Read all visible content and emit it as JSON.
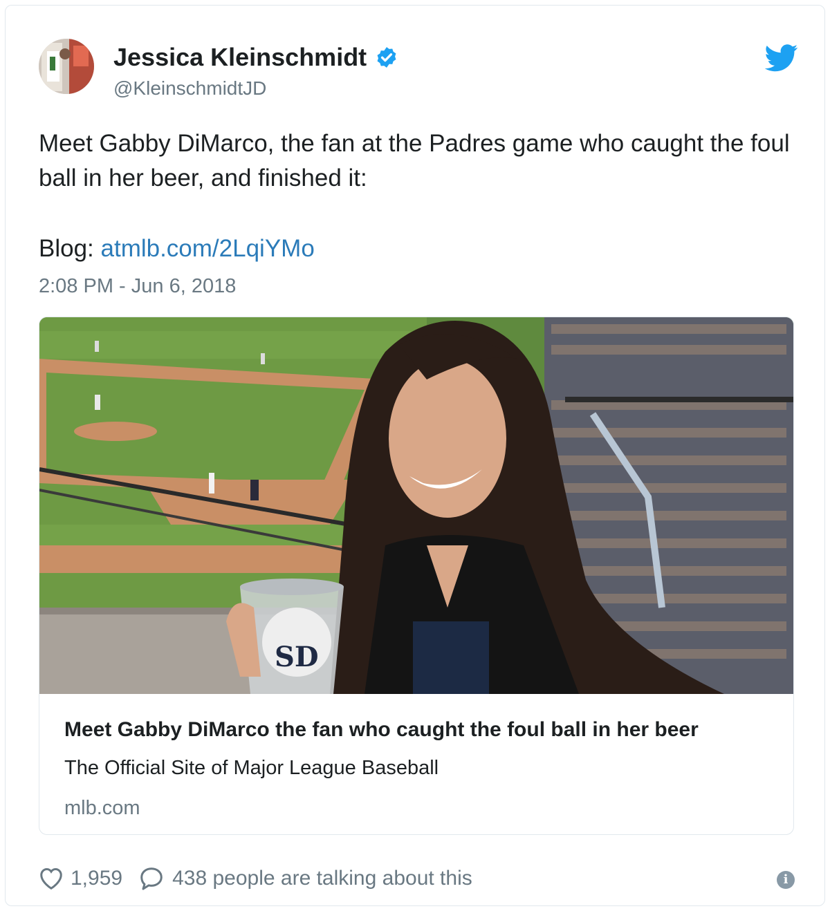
{
  "author": {
    "display_name": "Jessica Kleinschmidt",
    "handle": "@KleinschmidtJD",
    "verified": true
  },
  "tweet": {
    "text": "Meet Gabby DiMarco, the fan at the Padres game who caught the foul ball in her beer, and finished it:",
    "blog_prefix": "Blog: ",
    "blog_link": "atmlb.com/2LqiYMo",
    "timestamp": "2:08 PM - Jun 6, 2018"
  },
  "card": {
    "title": "Meet Gabby DiMarco the fan who caught the foul ball in her beer",
    "description": "The Official Site of Major League Baseball",
    "domain": "mlb.com",
    "image_logo_text": "SD"
  },
  "actions": {
    "likes": "1,959",
    "talking": "438 people are talking about this",
    "info_glyph": "i"
  },
  "icons": {
    "verified": "verified-badge-icon",
    "twitter": "twitter-bird-icon",
    "heart": "heart-icon",
    "reply": "speech-bubble-icon",
    "info": "info-icon"
  },
  "colors": {
    "link": "#2b7bb9",
    "twitter_blue": "#1da1f2",
    "muted": "#697882"
  }
}
